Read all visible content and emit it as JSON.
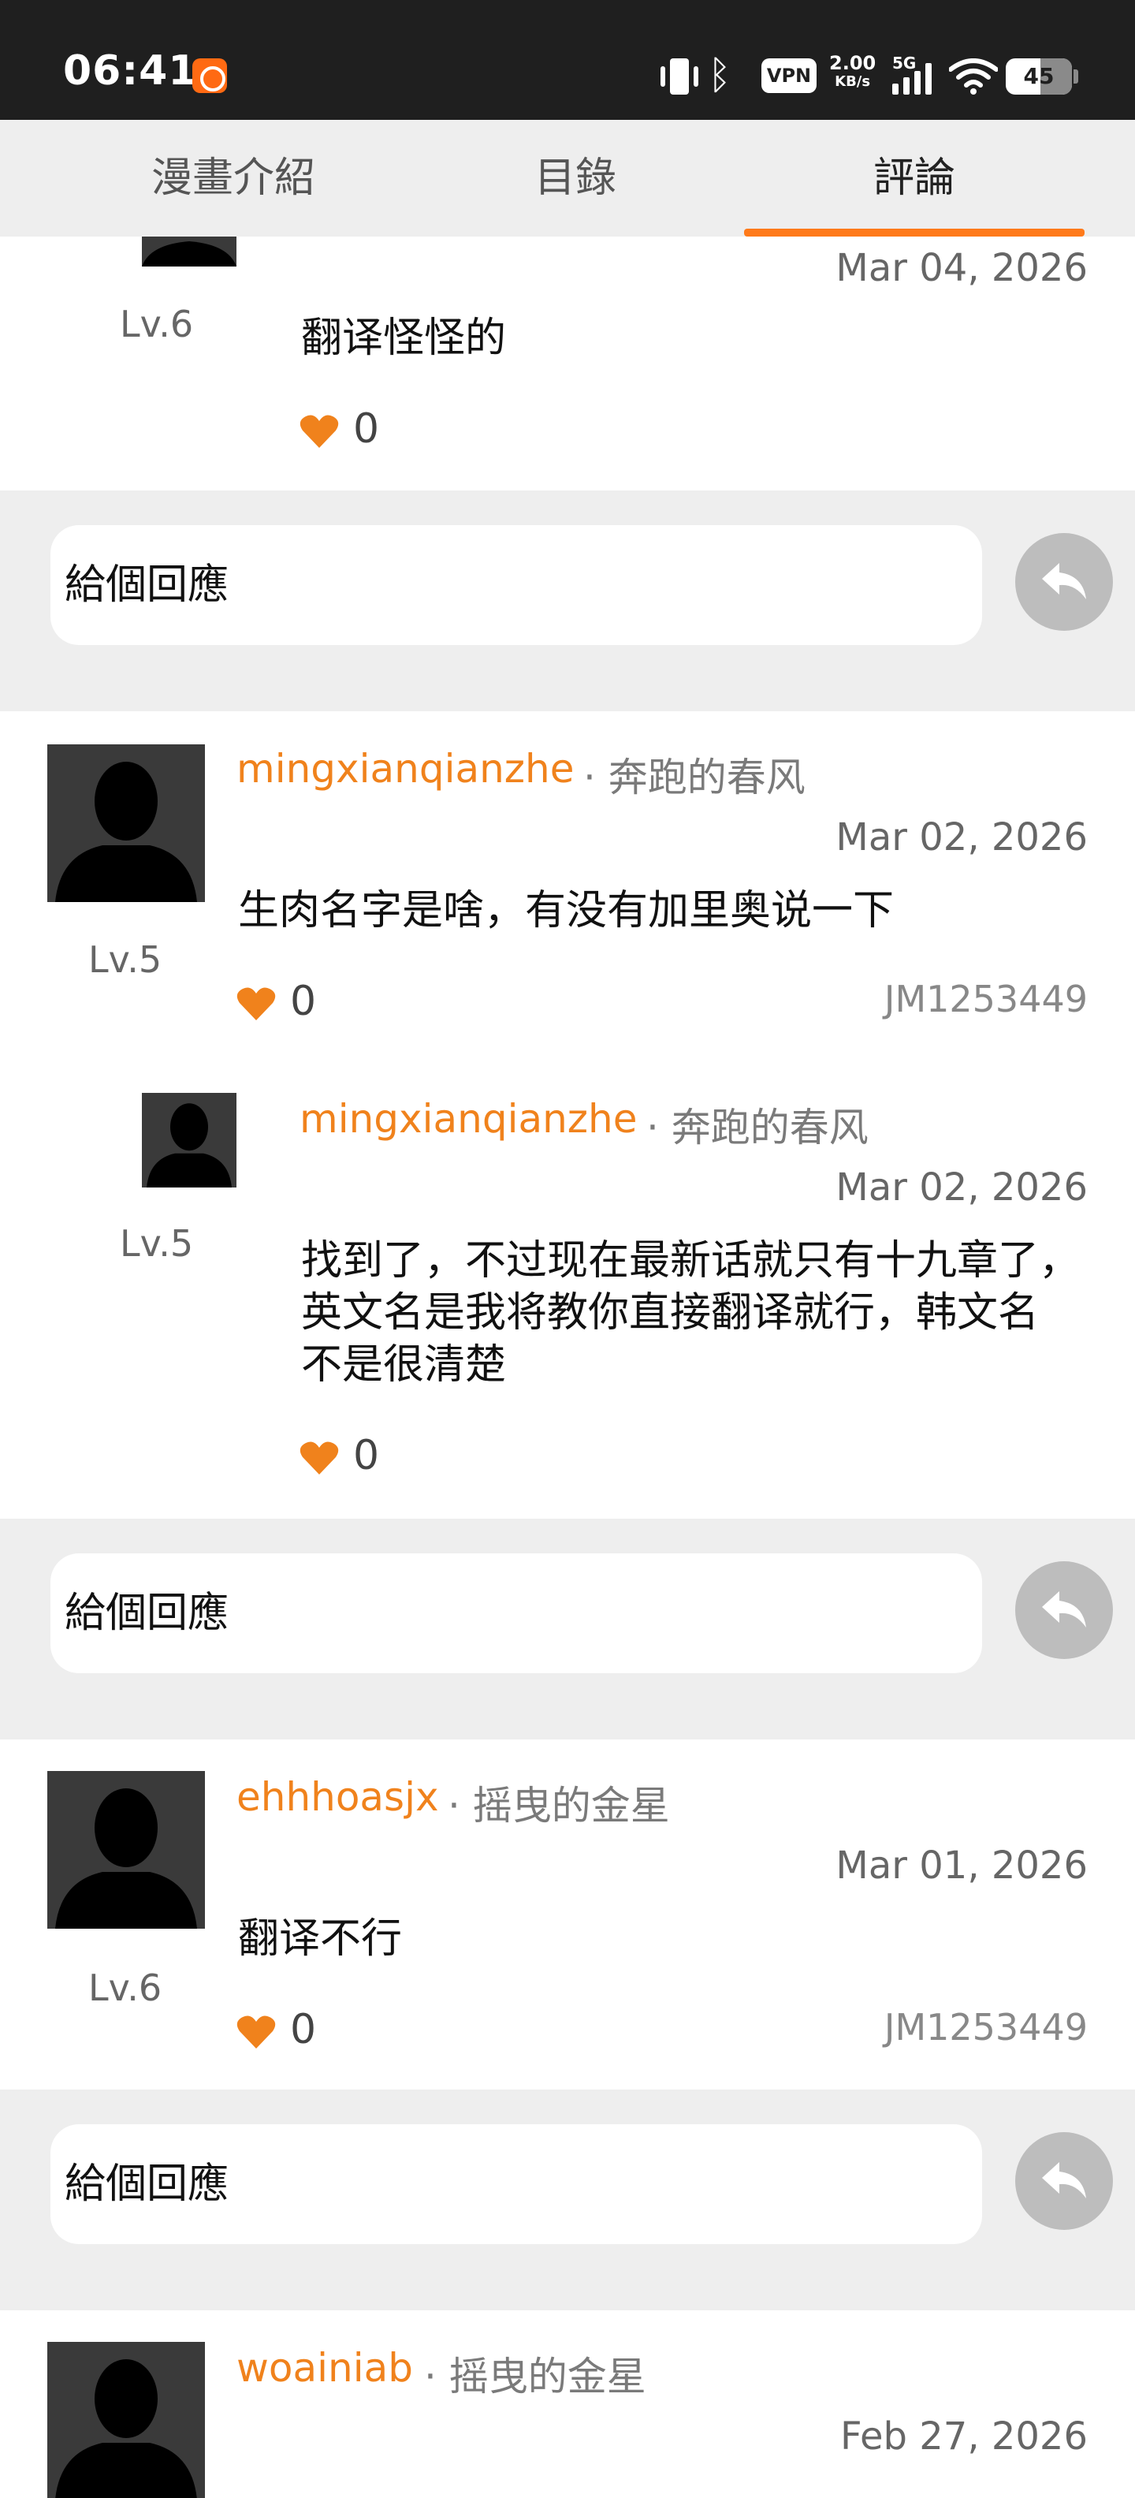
{
  "status_bar": {
    "time": "06:41",
    "vpn": "VPN",
    "speed_value": "2.00",
    "speed_unit": "KB/s",
    "network": "5G",
    "battery": "45"
  },
  "tabs": [
    {
      "label": "漫畫介紹"
    },
    {
      "label": "目錄"
    },
    {
      "label": "評論"
    }
  ],
  "accent_color": "#f0821c",
  "comments": [
    {
      "level": "Lv.6",
      "date": "Mar 04, 2026",
      "text": "翻译怪怪的",
      "likes": "0"
    },
    {
      "username": "mingxianqianzhe",
      "title": "· 奔跑的春风",
      "level": "Lv.5",
      "date": "Mar 02, 2026",
      "text": "生肉名字是啥，有没有加里奥说一下",
      "likes": "0",
      "comic_id": "JM1253449"
    },
    {
      "username": "mingxianqianzhe",
      "title": "· 奔跑的春风",
      "level": "Lv.5",
      "date": "Mar 02, 2026",
      "text_lines": [
        "找到了，不过现在最新话就只有十九章了，",
        "英文名是我将教你直接翻译就行，韩文名",
        "不是很清楚"
      ],
      "likes": "0"
    },
    {
      "username": "ehhhoasjx",
      "title": "· 摇曳的金星",
      "level": "Lv.6",
      "date": "Mar 01, 2026",
      "text": "翻译不行",
      "likes": "0",
      "comic_id": "JM1253449"
    },
    {
      "username": "woainiab",
      "title": "· 摇曳的金星",
      "date": "Feb 27, 2026"
    }
  ],
  "reply": {
    "placeholder": "給個回應"
  }
}
